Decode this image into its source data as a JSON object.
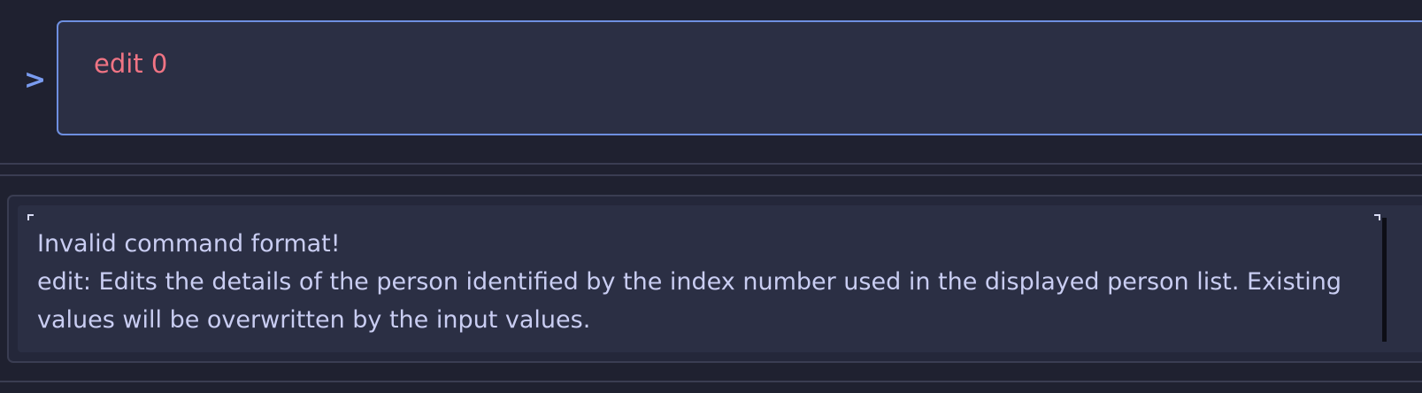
{
  "command": {
    "prompt": ">",
    "value": "edit 0"
  },
  "result": {
    "line1": "Invalid command format!",
    "line2": "edit: Edits the details of the person identified by the index number used in the displayed person list. Existing values will be overwritten by the input values."
  },
  "colors": {
    "background": "#1f2130",
    "panel": "#2b2f44",
    "accent": "#7a9cf0",
    "command_text": "#f07484",
    "result_text": "#c9cdf2"
  }
}
